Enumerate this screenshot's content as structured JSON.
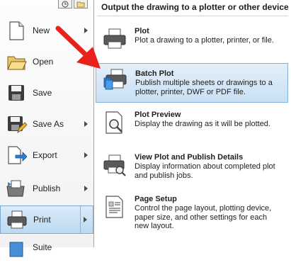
{
  "left_menu": {
    "items": [
      {
        "label": "New",
        "icon": "new-document-icon",
        "has_submenu": true
      },
      {
        "label": "Open",
        "icon": "open-folder-icon",
        "has_submenu": true
      },
      {
        "label": "Save",
        "icon": "save-disk-icon",
        "has_submenu": false
      },
      {
        "label": "Save As",
        "icon": "save-as-icon",
        "has_submenu": true
      },
      {
        "label": "Export",
        "icon": "export-icon",
        "has_submenu": true
      },
      {
        "label": "Publish",
        "icon": "publish-icon",
        "has_submenu": true
      },
      {
        "label": "Print",
        "icon": "printer-icon",
        "has_submenu": true,
        "selected": true
      },
      {
        "label": "Suite",
        "icon": "suite-icon",
        "has_submenu": false
      }
    ]
  },
  "submenu": {
    "title": "Output the drawing to a plotter or other device",
    "items": [
      {
        "title": "Plot",
        "description": "Plot a drawing to a plotter, printer, or file.",
        "icon": "printer-icon"
      },
      {
        "title": "Batch Plot",
        "description": "Publish multiple sheets or drawings to a plotter, printer, DWF or PDF file.",
        "icon": "batch-plot-icon",
        "highlighted": true
      },
      {
        "title": "Plot Preview",
        "description": "Display the drawing as it will be plotted.",
        "icon": "plot-preview-icon"
      },
      {
        "title": "View Plot and Publish Details",
        "description": "Display information about completed plot and publish jobs.",
        "icon": "plot-details-icon"
      },
      {
        "title": "Page Setup",
        "description": "Control the page layout, plotting device, paper size, and other settings for each new layout.",
        "icon": "page-setup-icon"
      }
    ]
  },
  "colors": {
    "highlight": "#c9e0f4",
    "highlight_border": "#86b0dd",
    "annotation_arrow": "#e8221b"
  }
}
